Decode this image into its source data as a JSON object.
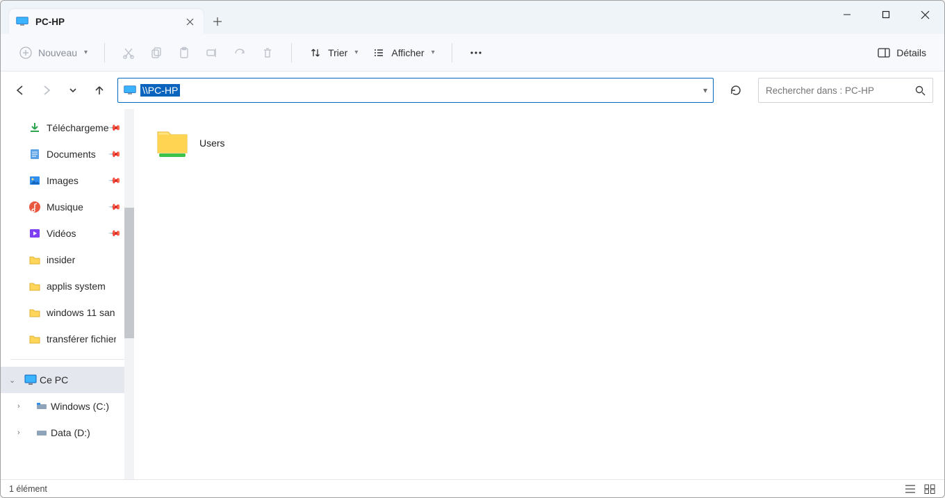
{
  "tab": {
    "title": "PC-HP"
  },
  "toolbar": {
    "new_label": "Nouveau",
    "sort_label": "Trier",
    "view_label": "Afficher",
    "details_label": "Détails"
  },
  "address": {
    "path": "\\\\PC-HP"
  },
  "search": {
    "placeholder": "Rechercher dans : PC-HP"
  },
  "sidebar": {
    "quick": [
      {
        "label": "Téléchargeme",
        "icon": "download",
        "pinned": true
      },
      {
        "label": "Documents",
        "icon": "document",
        "pinned": true
      },
      {
        "label": "Images",
        "icon": "images",
        "pinned": true
      },
      {
        "label": "Musique",
        "icon": "music",
        "pinned": true
      },
      {
        "label": "Vidéos",
        "icon": "video",
        "pinned": true
      },
      {
        "label": "insider",
        "icon": "folder",
        "pinned": false
      },
      {
        "label": "applis system",
        "icon": "folder",
        "pinned": false
      },
      {
        "label": "windows 11 san",
        "icon": "folder",
        "pinned": false
      },
      {
        "label": "transférer fichier",
        "icon": "folder",
        "pinned": false
      }
    ],
    "thispc_label": "Ce PC",
    "drives": [
      {
        "label": "Windows (C:)"
      },
      {
        "label": "Data (D:)"
      }
    ]
  },
  "content": {
    "items": [
      {
        "label": "Users"
      }
    ]
  },
  "status": {
    "count_label": "1 élément"
  }
}
